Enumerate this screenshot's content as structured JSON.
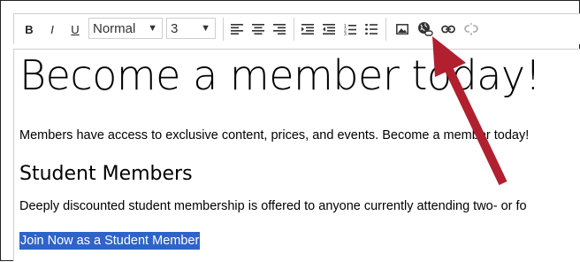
{
  "toolbar": {
    "bold_label": "B",
    "italic_label": "I",
    "underline_label": "U",
    "format_select": "Normal",
    "size_select": "3"
  },
  "editor": {
    "heading1": "Become a member today!",
    "paragraph1": "Members have access to exclusive content, prices, and events. Become a member today!",
    "heading2": "Student Members",
    "paragraph2": "Deeply discounted student membership is offered to anyone currently attending two- or fo",
    "selected_link_text": "Join Now as a Student Member"
  },
  "annotation": {
    "arrow_color": "#b0202e"
  },
  "icons": [
    "align-left-icon",
    "align-center-icon",
    "align-right-icon",
    "indent-icon",
    "outdent-icon",
    "ordered-list-icon",
    "bullet-list-icon",
    "image-icon",
    "web-link-icon",
    "link-icon",
    "unlink-icon"
  ]
}
